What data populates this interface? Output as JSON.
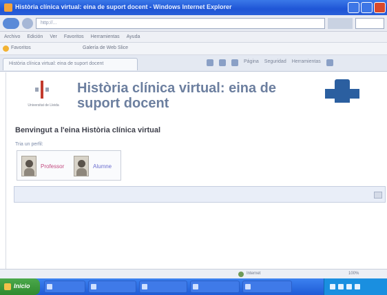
{
  "window": {
    "title": "Història clínica virtual: eina de suport docent - Windows Internet Explorer"
  },
  "address_bar": {
    "url": "http://...",
    "search_placeholder": ""
  },
  "menu": [
    "Archivo",
    "Edición",
    "Ver",
    "Favoritos",
    "Herramientas",
    "Ayuda"
  ],
  "favorites_bar": {
    "items": [
      "Favoritos",
      "",
      "Galería de Web Slice",
      ""
    ]
  },
  "tab": {
    "label": "Història clínica virtual: eina de suport docent"
  },
  "command_bar": [
    "Página",
    "Seguridad",
    "Herramientas"
  ],
  "page": {
    "university_caption": "Universitat de Lleida",
    "title": "Història clínica virtual: eina de suport docent",
    "right_logo_caption_1": "",
    "right_logo_caption_2": "",
    "welcome": "Benvingut a l'eina Història clínica virtual",
    "prompt": "Tria un perfil:",
    "profiles": [
      {
        "label": "Professor"
      },
      {
        "label": "Alumne"
      }
    ],
    "notice": ""
  },
  "status_bar": {
    "zone": "Internet",
    "zoom": "100%"
  },
  "taskbar": {
    "start_label": "Inicio",
    "tasks": [
      "",
      "",
      "",
      "",
      ""
    ]
  }
}
